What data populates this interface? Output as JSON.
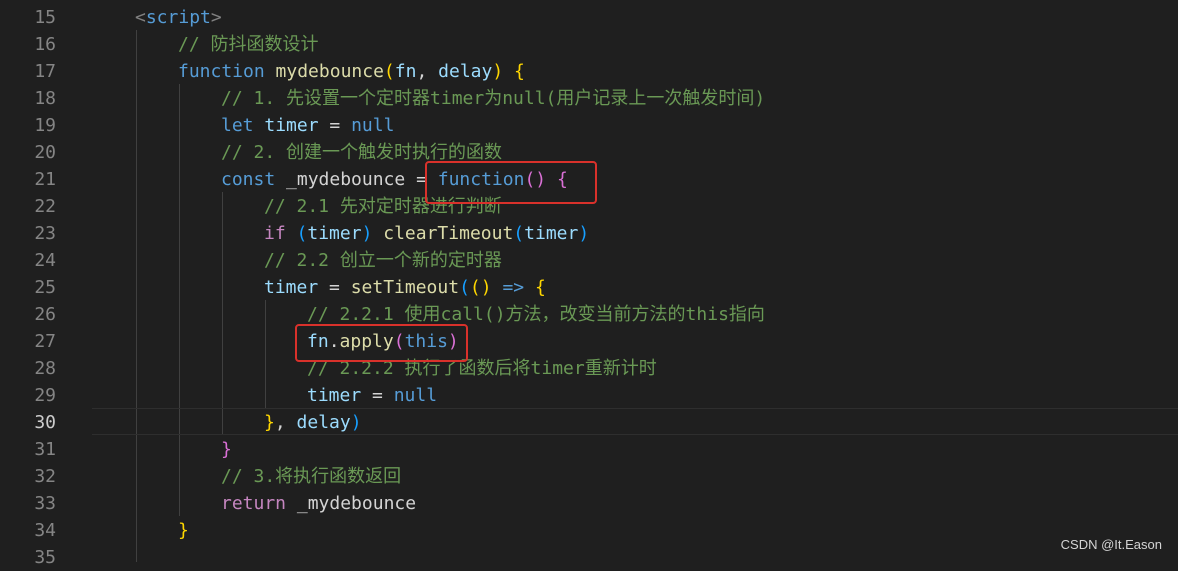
{
  "editor": {
    "active_line": 30,
    "lines": [
      {
        "num": "15",
        "tokens": [
          {
            "t": "<",
            "c": "t-tag"
          },
          {
            "t": "script",
            "c": "t-tagname"
          },
          {
            "t": ">",
            "c": "t-tag"
          }
        ],
        "indent": 2
      },
      {
        "num": "16",
        "tokens": [
          {
            "t": "// 防抖函数设计",
            "c": "t-cm"
          }
        ],
        "indent": 3
      },
      {
        "num": "17",
        "tokens": [
          {
            "t": "function",
            "c": "t-kw"
          },
          {
            "t": " ",
            "c": "t-op"
          },
          {
            "t": "mydebounce",
            "c": "t-fn"
          },
          {
            "t": "(",
            "c": "t-p1"
          },
          {
            "t": "fn",
            "c": "t-var"
          },
          {
            "t": ", ",
            "c": "t-op"
          },
          {
            "t": "delay",
            "c": "t-var"
          },
          {
            "t": ")",
            "c": "t-p1"
          },
          {
            "t": " ",
            "c": "t-op"
          },
          {
            "t": "{",
            "c": "t-p1"
          }
        ],
        "indent": 3
      },
      {
        "num": "18",
        "tokens": [
          {
            "t": "// 1. 先设置一个定时器timer为null(用户记录上一次触发时间)",
            "c": "t-cm"
          }
        ],
        "indent": 4
      },
      {
        "num": "19",
        "tokens": [
          {
            "t": "let",
            "c": "t-kw"
          },
          {
            "t": " ",
            "c": "t-op"
          },
          {
            "t": "timer",
            "c": "t-var"
          },
          {
            "t": " = ",
            "c": "t-op"
          },
          {
            "t": "null",
            "c": "t-kw"
          }
        ],
        "indent": 4
      },
      {
        "num": "20",
        "tokens": [
          {
            "t": "// 2. 创建一个触发时执行的函数",
            "c": "t-cm"
          }
        ],
        "indent": 4
      },
      {
        "num": "21",
        "tokens": [
          {
            "t": "const",
            "c": "t-kw"
          },
          {
            "t": " _mydebounce = ",
            "c": "t-op"
          },
          {
            "t": "function",
            "c": "t-kw"
          },
          {
            "t": "(",
            "c": "t-p2"
          },
          {
            "t": ")",
            "c": "t-p2"
          },
          {
            "t": " ",
            "c": "t-op"
          },
          {
            "t": "{",
            "c": "t-p2"
          }
        ],
        "indent": 4
      },
      {
        "num": "22",
        "tokens": [
          {
            "t": "// 2.1 先对定时器进行判断",
            "c": "t-cm"
          }
        ],
        "indent": 5
      },
      {
        "num": "23",
        "tokens": [
          {
            "t": "if",
            "c": "t-ctl"
          },
          {
            "t": " ",
            "c": "t-op"
          },
          {
            "t": "(",
            "c": "t-p3"
          },
          {
            "t": "timer",
            "c": "t-var"
          },
          {
            "t": ")",
            "c": "t-p3"
          },
          {
            "t": " ",
            "c": "t-op"
          },
          {
            "t": "clearTimeout",
            "c": "t-fn"
          },
          {
            "t": "(",
            "c": "t-p3"
          },
          {
            "t": "timer",
            "c": "t-var"
          },
          {
            "t": ")",
            "c": "t-p3"
          }
        ],
        "indent": 5
      },
      {
        "num": "24",
        "tokens": [
          {
            "t": "// 2.2 创立一个新的定时器",
            "c": "t-cm"
          }
        ],
        "indent": 5
      },
      {
        "num": "25",
        "tokens": [
          {
            "t": "timer",
            "c": "t-var"
          },
          {
            "t": " = ",
            "c": "t-op"
          },
          {
            "t": "setTimeout",
            "c": "t-fn"
          },
          {
            "t": "(",
            "c": "t-p3"
          },
          {
            "t": "(",
            "c": "t-p1"
          },
          {
            "t": ")",
            "c": "t-p1"
          },
          {
            "t": " ",
            "c": "t-op"
          },
          {
            "t": "=>",
            "c": "t-kw"
          },
          {
            "t": " ",
            "c": "t-op"
          },
          {
            "t": "{",
            "c": "t-p1"
          }
        ],
        "indent": 5
      },
      {
        "num": "26",
        "tokens": [
          {
            "t": "// 2.2.1 使用call()方法，改变当前方法的this指向",
            "c": "t-cm"
          }
        ],
        "indent": 6
      },
      {
        "num": "27",
        "tokens": [
          {
            "t": "fn",
            "c": "t-var"
          },
          {
            "t": ".",
            "c": "t-op"
          },
          {
            "t": "apply",
            "c": "t-fn"
          },
          {
            "t": "(",
            "c": "t-p2"
          },
          {
            "t": "this",
            "c": "t-kw"
          },
          {
            "t": ")",
            "c": "t-p2"
          }
        ],
        "indent": 6
      },
      {
        "num": "28",
        "tokens": [
          {
            "t": "// 2.2.2 执行了函数后将timer重新计时",
            "c": "t-cm"
          }
        ],
        "indent": 6
      },
      {
        "num": "29",
        "tokens": [
          {
            "t": "timer",
            "c": "t-var"
          },
          {
            "t": " = ",
            "c": "t-op"
          },
          {
            "t": "null",
            "c": "t-kw"
          }
        ],
        "indent": 6
      },
      {
        "num": "30",
        "tokens": [
          {
            "t": "}",
            "c": "t-p1"
          },
          {
            "t": ", ",
            "c": "t-op"
          },
          {
            "t": "delay",
            "c": "t-var"
          },
          {
            "t": ")",
            "c": "t-p3"
          }
        ],
        "indent": 5
      },
      {
        "num": "31",
        "tokens": [
          {
            "t": "}",
            "c": "t-p2"
          }
        ],
        "indent": 4
      },
      {
        "num": "32",
        "tokens": [
          {
            "t": "// 3.将执行函数返回",
            "c": "t-cm"
          }
        ],
        "indent": 4
      },
      {
        "num": "33",
        "tokens": [
          {
            "t": "return",
            "c": "t-ctl"
          },
          {
            "t": " _mydebounce",
            "c": "t-op"
          }
        ],
        "indent": 4
      },
      {
        "num": "34",
        "tokens": [
          {
            "t": "}",
            "c": "t-p1"
          }
        ],
        "indent": 3
      },
      {
        "num": "35",
        "tokens": [],
        "indent": 0
      }
    ]
  },
  "watermark": "CSDN @It.Eason",
  "colors": {
    "background": "#1f1f1f",
    "highlight_box": "#d9312b"
  }
}
